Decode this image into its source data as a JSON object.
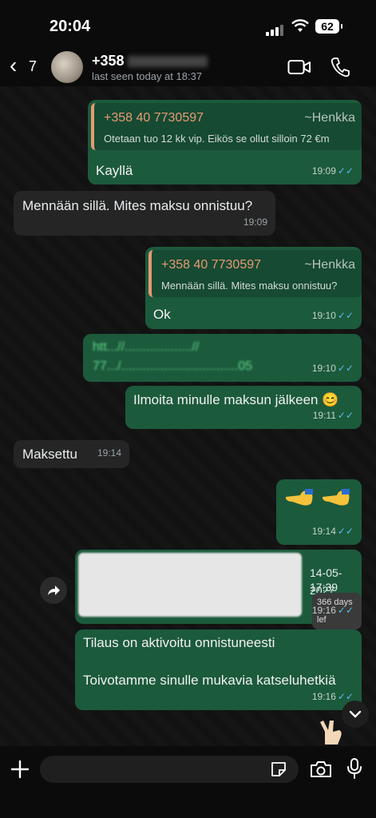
{
  "status_bar": {
    "time": "20:04",
    "battery": "62"
  },
  "header": {
    "back_count": "7",
    "contact_name": "+358",
    "last_seen": "last seen today at 18:37"
  },
  "messages": [
    {
      "id": "m1",
      "direction": "out",
      "quote": {
        "number": "+358 40 7730597",
        "name": "~Henkka",
        "text": "Otetaan tuo 12 kk vip. Eikös se ollut silloin 72 €m"
      },
      "text": "Kayllä",
      "time": "19:09"
    },
    {
      "id": "m2",
      "direction": "in",
      "text": "Mennään sillä. Mites maksu onnistuu?",
      "time": "19:09"
    },
    {
      "id": "m3",
      "direction": "out",
      "quote": {
        "number": "+358 40 7730597",
        "name": "~Henkka",
        "text": "Mennään sillä. Mites maksu onnistuu?"
      },
      "text": "Ok",
      "time": "19:10"
    },
    {
      "id": "m4",
      "direction": "out",
      "link_line1": "htt...//...................//",
      "link_line2": "77.../.................................05",
      "time": "19:10"
    },
    {
      "id": "m5",
      "direction": "out",
      "text": "Ilmoita minulle maksun jälkeen 😊",
      "time": "19:11"
    },
    {
      "id": "m6",
      "direction": "in",
      "text": "Maksettu",
      "time": "19:14"
    },
    {
      "id": "m7",
      "direction": "out",
      "emoji": "pointing-hands",
      "time": "19:14"
    },
    {
      "id": "m8",
      "direction": "out",
      "date": "14-05-2027",
      "clock": "17:39",
      "days_left": "366 days lef",
      "time": "19:16"
    },
    {
      "id": "m9",
      "direction": "out",
      "line1": "Tilaus on aktivoitu onnistuneesti",
      "line2": "Toivotamme sinulle mukavia katseluhetkiä",
      "time": "19:16"
    }
  ],
  "colors": {
    "outgoing_bubble": "#1c5a3c",
    "incoming_bubble": "#252525",
    "quote_accent": "#e79a74",
    "read_tick": "#53bdeb"
  }
}
